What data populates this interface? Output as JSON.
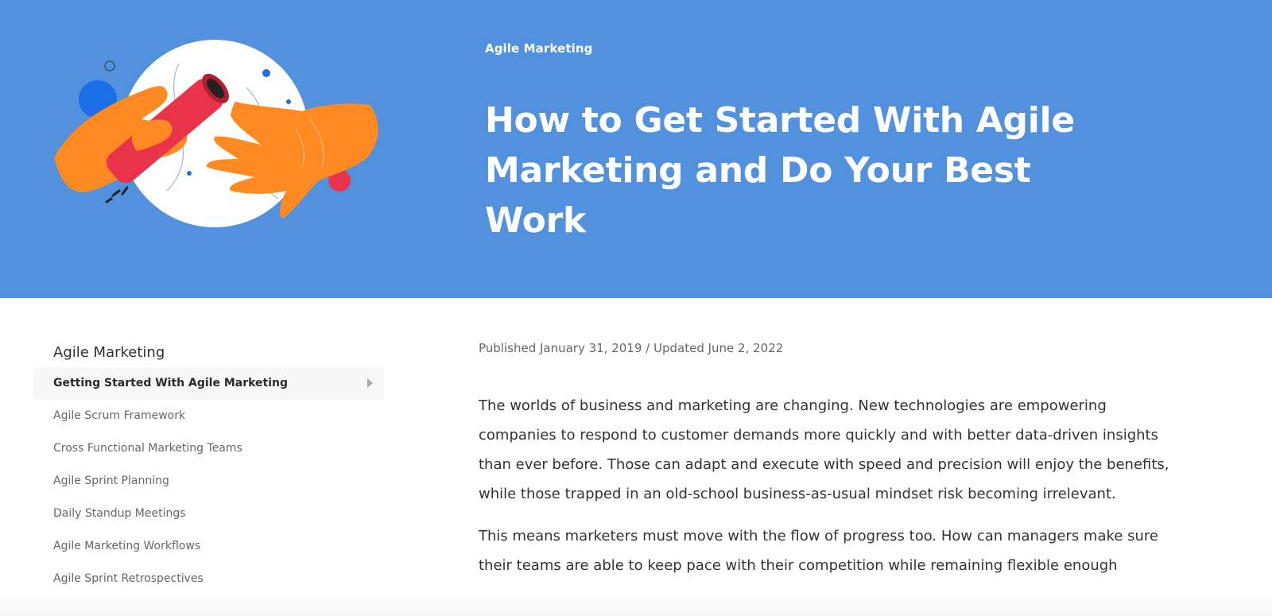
{
  "hero": {
    "category": "Agile Marketing",
    "title": "How to Get Started With Agile Marketing and Do Your Best Work",
    "illustration_icon": "hands-passing-baton-illustration",
    "background_color": "#5291dd"
  },
  "sidebar": {
    "heading": "Agile Marketing",
    "items": [
      {
        "label": "Getting Started With Agile Marketing",
        "active": true
      },
      {
        "label": "Agile Scrum Framework"
      },
      {
        "label": "Cross Functional Marketing Teams"
      },
      {
        "label": "Agile Sprint Planning"
      },
      {
        "label": "Daily Standup Meetings"
      },
      {
        "label": "Agile Marketing Workflows"
      },
      {
        "label": "Agile Sprint Retrospectives"
      }
    ]
  },
  "article": {
    "meta": "Published January 31, 2019 / Updated June 2, 2022",
    "paragraphs": [
      "The worlds of business and marketing are changing. New technologies are empowering companies to respond to customer demands more quickly and with better data-driven insights than ever before. Those can adapt and execute with speed and precision will enjoy the benefits, while those trapped in an old-school business-as-usual mindset risk becoming irrelevant.",
      "This means marketers must move with the flow of progress too. How can managers make sure their teams are able to keep pace with their competition while remaining flexible enough"
    ]
  }
}
